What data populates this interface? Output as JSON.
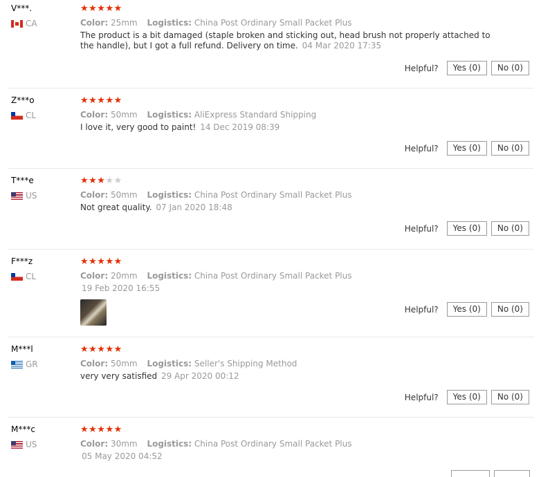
{
  "helpful_label": "Helpful?",
  "reviews": [
    {
      "user": "V***.",
      "country": "CA",
      "flag": "canada-flag-icon",
      "rating": 5,
      "color_label": "Color:",
      "color": "25mm",
      "logistics_label": "Logistics:",
      "logistics": "China Post Ordinary Small Packet Plus",
      "text": "The product is a bit damaged (staple broken and sticking out, head brush not properly attached to the handle), but I got a full refund. Delivery on time.",
      "date": "04 Mar 2020 17:35",
      "yes": "Yes (0)",
      "no": "No (0)"
    },
    {
      "user": "Z***o",
      "country": "CL",
      "flag": "chile-flag-icon",
      "rating": 5,
      "color_label": "Color:",
      "color": "50mm",
      "logistics_label": "Logistics:",
      "logistics": "AliExpress Standard Shipping",
      "text": "I love it, very good to paint!",
      "date": "14 Dec 2019 08:39",
      "yes": "Yes (0)",
      "no": "No (0)"
    },
    {
      "user": "T***e",
      "country": "US",
      "flag": "usa-flag-icon",
      "rating": 3,
      "color_label": "Color:",
      "color": "50mm",
      "logistics_label": "Logistics:",
      "logistics": "China Post Ordinary Small Packet Plus",
      "text": "Not great quality.",
      "date": "07 Jan 2020 18:48",
      "yes": "Yes (0)",
      "no": "No (0)"
    },
    {
      "user": "F***z",
      "country": "CL",
      "flag": "chile-flag-icon",
      "rating": 5,
      "color_label": "Color:",
      "color": "20mm",
      "logistics_label": "Logistics:",
      "logistics": "China Post Ordinary Small Packet Plus",
      "text": "",
      "date": "19 Feb 2020 16:55",
      "yes": "Yes (0)",
      "no": "No (0)"
    },
    {
      "user": "M***l",
      "country": "GR",
      "flag": "greece-flag-icon",
      "rating": 5,
      "color_label": "Color:",
      "color": "50mm",
      "logistics_label": "Logistics:",
      "logistics": "Seller's Shipping Method",
      "text": "very very satisfied",
      "date": "29 Apr 2020 00:12",
      "yes": "Yes (0)",
      "no": "No (0)"
    },
    {
      "user": "M***c",
      "country": "US",
      "flag": "usa-flag-icon",
      "rating": 5,
      "color_label": "Color:",
      "color": "30mm",
      "logistics_label": "Logistics:",
      "logistics": "China Post Ordinary Small Packet Plus",
      "text": "",
      "date": "05 May 2020 04:52"
    }
  ],
  "colors": {
    "star": "#e62e04",
    "star_off": "#cccccc",
    "muted": "#999999"
  }
}
